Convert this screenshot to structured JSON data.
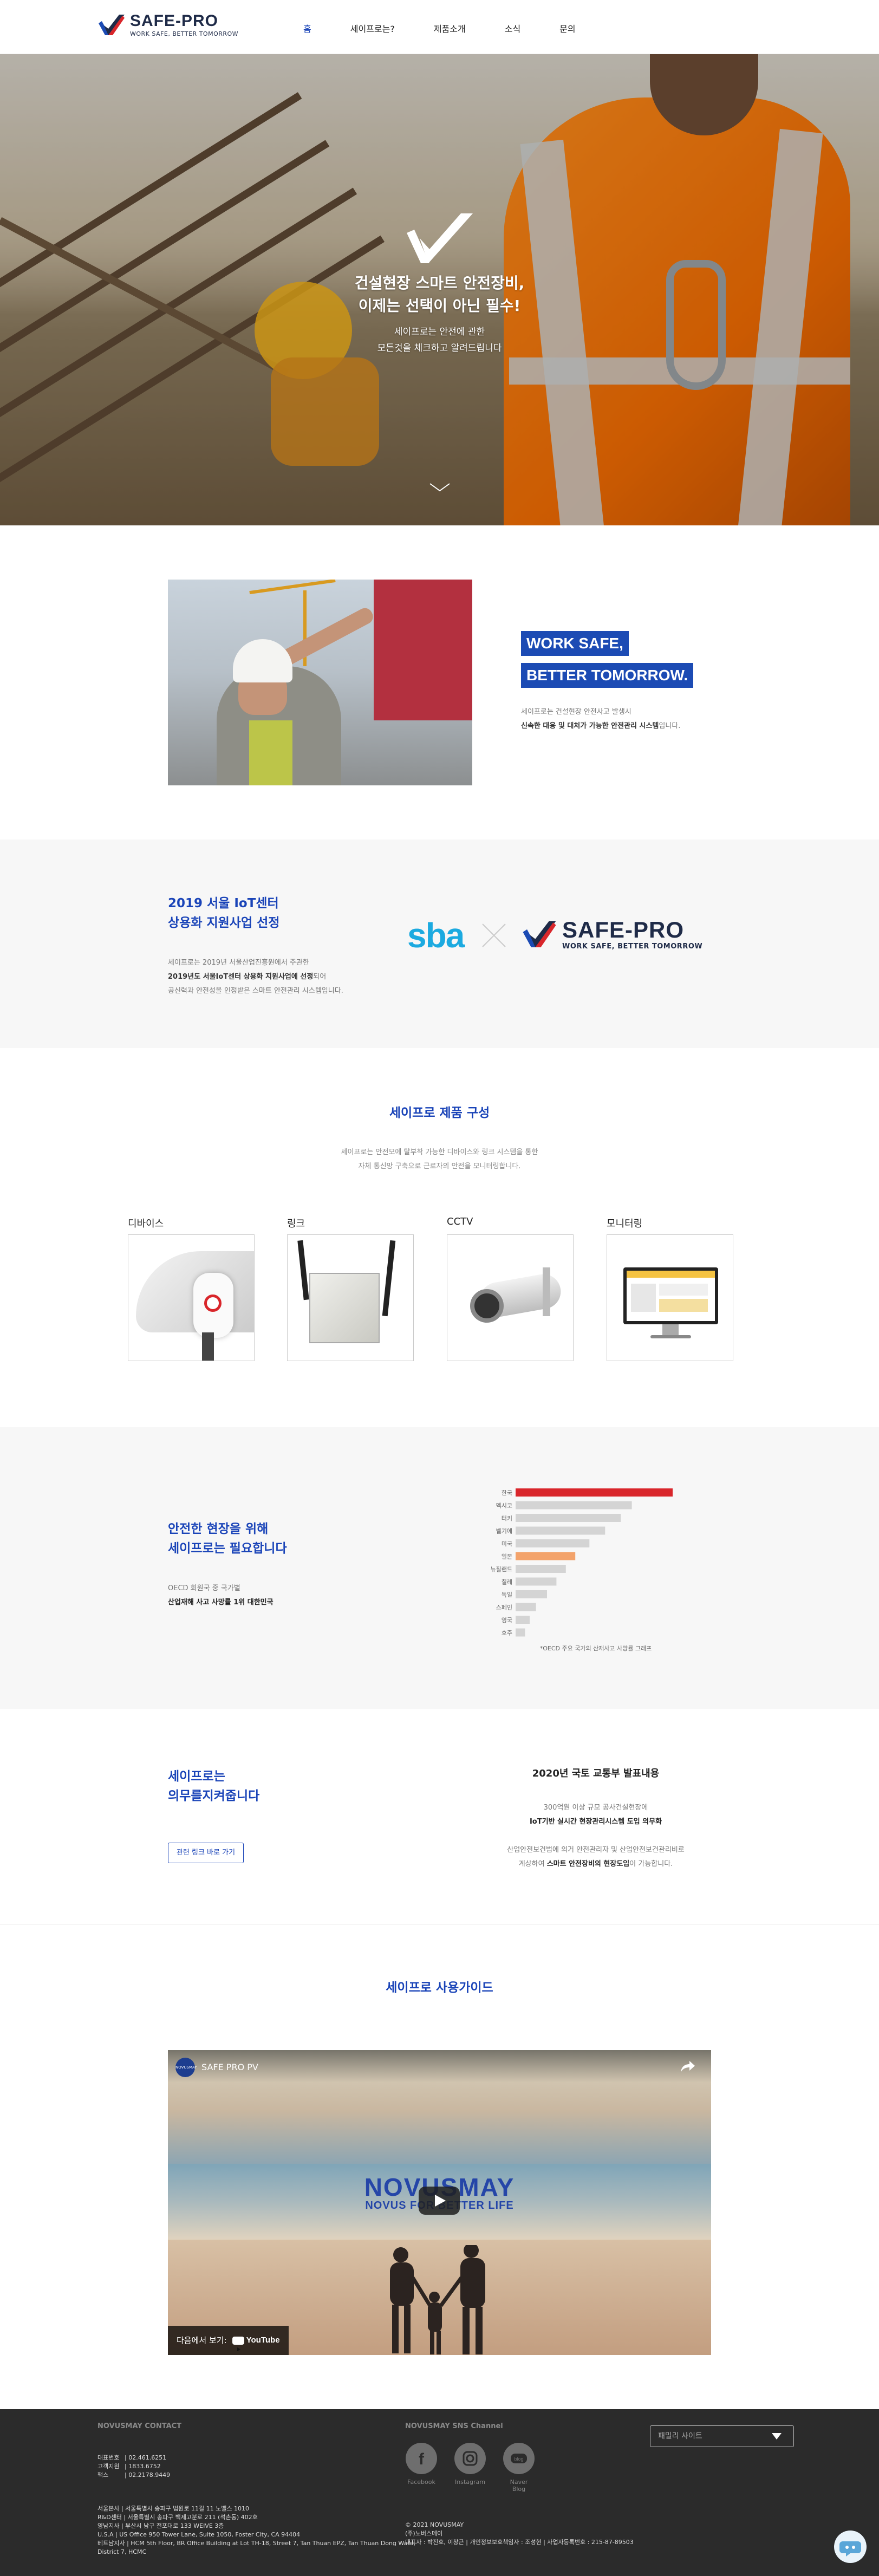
{
  "header": {
    "logo_name": "SAFE-PRO",
    "logo_tag": "WORK SAFE, BETTER TOMORROW",
    "nav": [
      "홈",
      "세이프로는?",
      "제품소개",
      "소식",
      "문의"
    ]
  },
  "hero": {
    "title_line1": "건설현장 스마트 안전장비,",
    "title_line2": "이제는 선택이 아닌 필수!",
    "sub_line1": "세이프로는 안전에 관한",
    "sub_line2": "모든것을 체크하고 알려드립니다"
  },
  "intro": {
    "badge1": "WORK SAFE,",
    "badge2": "BETTER TOMORROW.",
    "text_line1": "세이프로는 건설현장 안전사고 발생시",
    "text_bold": "신속한 대응 및 대처가 가능한 안전관리 시스템",
    "text_tail": "입니다."
  },
  "sba_section": {
    "title_line1": "2019 서울 IoT센터",
    "title_line2": "상용화 지원사업 선정",
    "text_line1": "세이프로는 2019년 서울산업진흥원에서 주관한",
    "text_bold": "2019년도 서울IoT센터 상용화 지원사업에 선정",
    "text_tail": "되어",
    "text_line3": "공신력과 안전성을 인정받은 스마트 안전관리 시스템입니다.",
    "partner": "sba",
    "logo_name": "SAFE-PRO",
    "logo_tag": "WORK SAFE, BETTER TOMORROW"
  },
  "products": {
    "title": "세이프로 제품 구성",
    "text_line1": "세이프로는 안전모에 탈부착 가능한 디바이스와 링크 시스템을 통한",
    "text_line2": "자체 통신망 구축으로 근로자의 안전을 모니터링합니다.",
    "items": [
      {
        "label": "디바이스"
      },
      {
        "label": "링크"
      },
      {
        "label": "CCTV"
      },
      {
        "label": "모니터링"
      }
    ]
  },
  "need": {
    "title_line1": "안전한 현장을 위해",
    "title_line2": "세이프로는 필요합니다",
    "text_line1": "OECD 회원국 중 국가별",
    "text_bold": "산업재해 사고 사망률 1위 대한민국",
    "chart_note": "*OECD 주요 국가의 산재사고 사망률 그래프"
  },
  "chart_data": {
    "type": "bar",
    "orientation": "horizontal",
    "categories": [
      "한국",
      "멕시코",
      "터키",
      "벨기에",
      "미국",
      "일본",
      "뉴질랜드",
      "칠레",
      "독일",
      "스페인",
      "영국",
      "호주"
    ],
    "values": [
      100,
      74,
      67,
      57,
      47,
      38,
      32,
      26,
      20,
      13,
      9,
      6
    ],
    "highlight": {
      "한국": "#d9262b",
      "일본": "#f3a36b"
    },
    "base_color": "#d4d4d4",
    "grid": false
  },
  "law": {
    "title_line1": "세이프로는",
    "title_line2": "의무를지켜줍니다",
    "button": "관련 링크 바로 가기",
    "r_title": "2020년 국토 교통부 발표내용",
    "r_line1": "300억원 이상 규모 공사건설현장에",
    "r_bold1": "IoT기반 실시간 현장관리시스템 도입 의무화",
    "r_line2": "산업안전보건법에 의거 안전관리자 및 산업안전보건관리비로",
    "r_line3a": "계상하여 ",
    "r_bold2": "스마트 안전장비의 현장도입",
    "r_line3b": "이 가능합니다."
  },
  "guide": {
    "title": "세이프로 사용가이드",
    "video_title": "SAFE PRO PV",
    "channel": "NOVUSMAY",
    "brand1": "NOVUSMAY",
    "brand2": "NOVUS FOR BETTER LIFE",
    "watch_on": "다음에서 보기:",
    "youtube": "YouTube"
  },
  "footer": {
    "contact_title": "NOVUSMAY CONTACT",
    "sns_title": "NOVUSMAY SNS Channel",
    "contacts": [
      {
        "k": "대표번호",
        "v": "02.461.6251"
      },
      {
        "k": "고객지원",
        "v": "1833.6752"
      },
      {
        "k": "팩스",
        "v": "02.2178.9449"
      }
    ],
    "offices": [
      "서울본사  |  서울특별시 송파구 법원로 11길 11 노벨스 1010",
      "R&D센터  |  서울특별시 송파구 백제고분로 211 (석촌동) 402호",
      "영남지사  |  부산시 남구 전포대로 133 WEIVE 3층",
      "U.S.A  |  US Office 950 Tower Lane, Suite 1050, Foster City, CA 94404",
      "베트남지사  |  HCM 5th Floor, BR Office Building at Lot TH-18, Street 7, Tan Thuan EPZ, Tan Thuan Dong Ward,",
      "District 7, HCMC"
    ],
    "sns": [
      "Facebook",
      "Instagram",
      "Naver Blog"
    ],
    "copyright": "© 2021 NOVUSMAY",
    "company": "(주)노버스메이",
    "biz": "대표자 : 박진호, 이창근  |  개인정보보호책임자 : 조성현  |  사업자등록번호 : 215-87-89503",
    "family_site": "패밀리 사이트"
  }
}
